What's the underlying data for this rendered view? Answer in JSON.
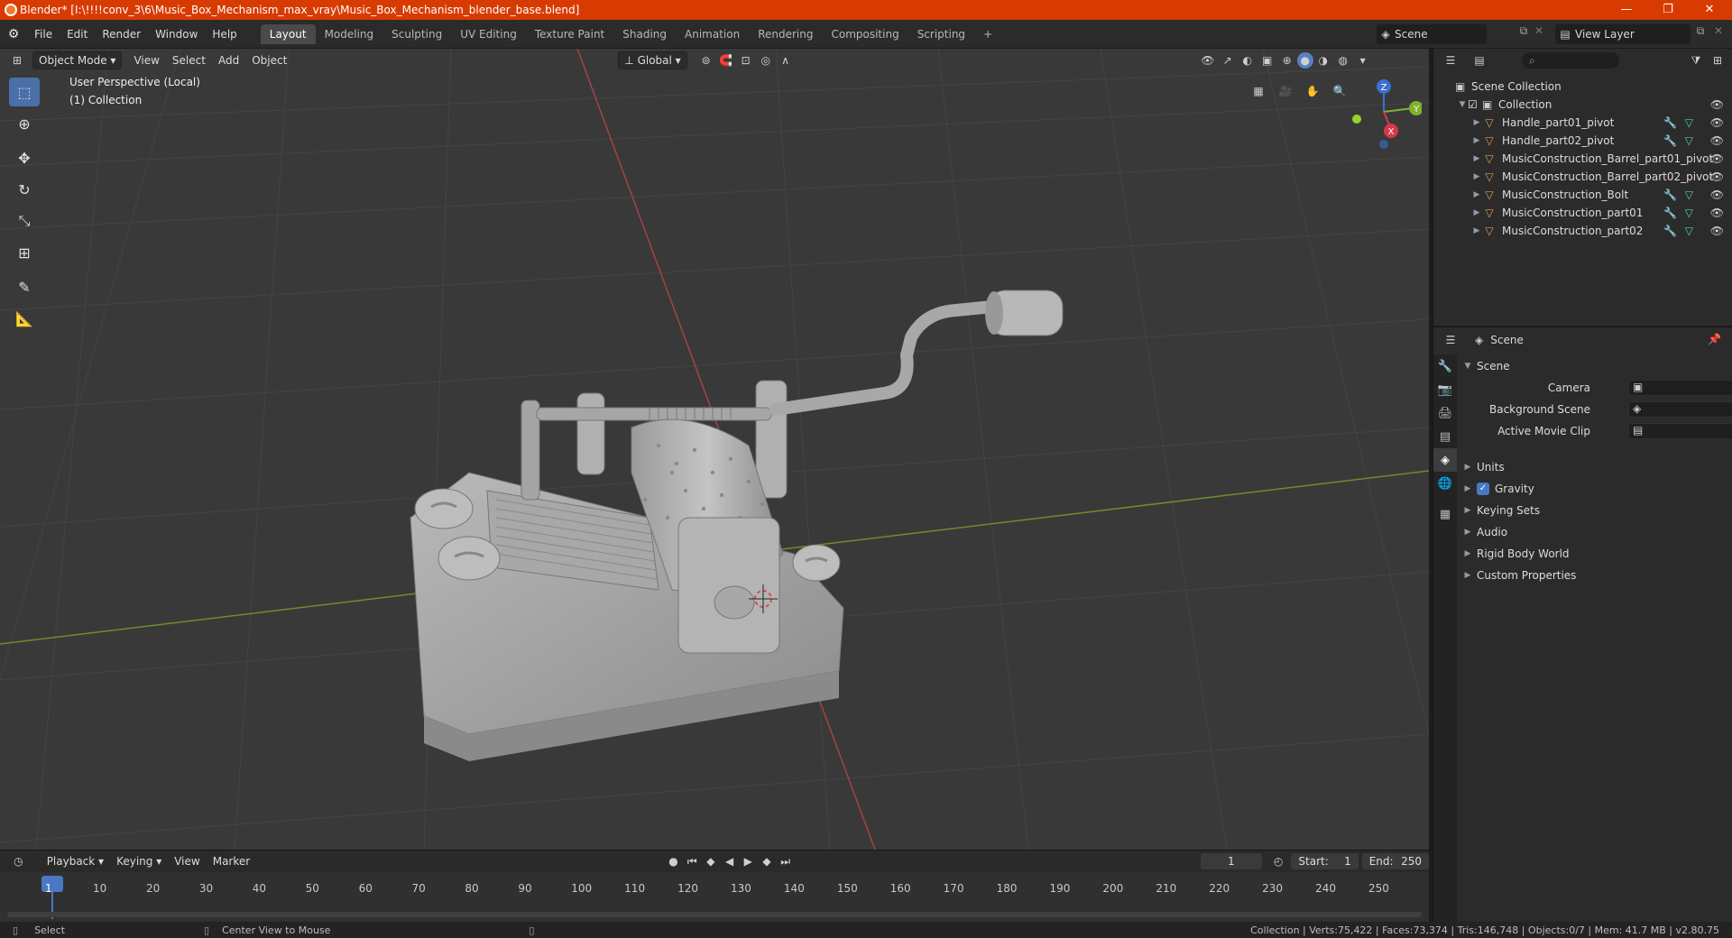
{
  "window": {
    "title": "Blender* [I:\\!!!!conv_3\\6\\Music_Box_Mechanism_max_vray\\Music_Box_Mechanism_blender_base.blend]",
    "minimize": "—",
    "restore": "❐",
    "close": "✕"
  },
  "menus": [
    "File",
    "Edit",
    "Render",
    "Window",
    "Help"
  ],
  "workspaces": {
    "active": "Layout",
    "tabs": [
      "Layout",
      "Modeling",
      "Sculpting",
      "UV Editing",
      "Texture Paint",
      "Shading",
      "Animation",
      "Rendering",
      "Compositing",
      "Scripting"
    ],
    "add": "+"
  },
  "scene_selector": "Scene",
  "view_layer": "View Layer",
  "viewport": {
    "mode": "Object Mode",
    "menus": [
      "View",
      "Select",
      "Add",
      "Object"
    ],
    "orientation": "Global",
    "perspective_label": "User Perspective (Local)",
    "collection_label": "(1) Collection",
    "gizmo": {
      "x": "X",
      "y": "Y",
      "z": "Z"
    }
  },
  "timeline": {
    "menus": [
      "Playback",
      "Keying",
      "View",
      "Marker"
    ],
    "current_frame": "1",
    "start_label": "Start:",
    "start_value": "1",
    "end_label": "End:",
    "end_value": "250",
    "ruler": [
      "1",
      "10",
      "20",
      "30",
      "40",
      "50",
      "60",
      "70",
      "80",
      "90",
      "100",
      "110",
      "120",
      "130",
      "140",
      "150",
      "160",
      "170",
      "180",
      "190",
      "200",
      "210",
      "220",
      "230",
      "240",
      "250"
    ]
  },
  "statusbar": {
    "left_action": "Select",
    "middle_action": "Center View to Mouse",
    "stats": "Collection | Verts:75,422 | Faces:73,374 | Tris:146,748 | Objects:0/7 | Mem: 41.7 MB | v2.80.75"
  },
  "outliner": {
    "root": "Scene Collection",
    "collection": "Collection",
    "items": [
      {
        "name": "Handle_part01_pivot",
        "mods": true
      },
      {
        "name": "Handle_part02_pivot",
        "mods": true
      },
      {
        "name": "MusicConstruction_Barrel_part01_pivot",
        "mods": false
      },
      {
        "name": "MusicConstruction_Barrel_part02_pivot",
        "mods": false
      },
      {
        "name": "MusicConstruction_Bolt",
        "mods": true
      },
      {
        "name": "MusicConstruction_part01",
        "mods": true
      },
      {
        "name": "MusicConstruction_part02",
        "mods": true
      }
    ]
  },
  "properties": {
    "context": "Scene",
    "panel_title": "Scene",
    "fields": {
      "camera": "Camera",
      "background_scene": "Background Scene",
      "active_movie_clip": "Active Movie Clip"
    },
    "sections": {
      "units": "Units",
      "gravity": "Gravity",
      "keying_sets": "Keying Sets",
      "audio": "Audio",
      "rigid_body_world": "Rigid Body World",
      "custom_properties": "Custom Properties"
    }
  }
}
